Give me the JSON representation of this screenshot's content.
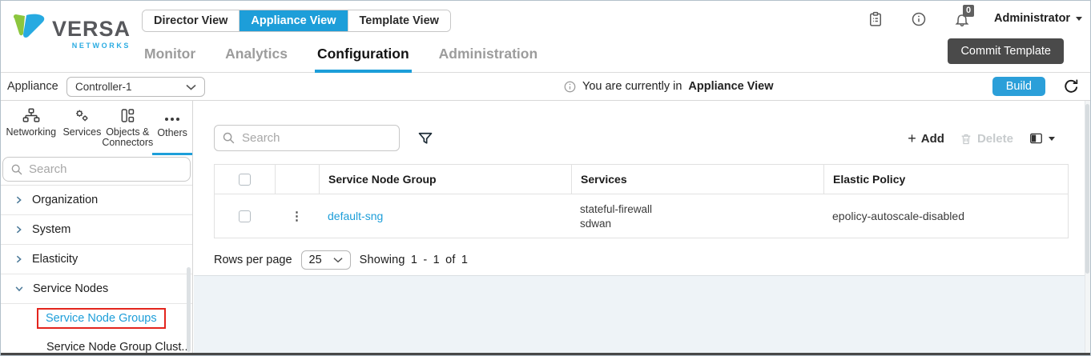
{
  "colors": {
    "accent": "#1d9ed9",
    "highlight_red": "#e3251d",
    "commit_gray": "#4a4a4a"
  },
  "header": {
    "logo": {
      "brand": "VERSA",
      "sub": "NETWORKS"
    },
    "view_tabs": [
      {
        "label": "Director View"
      },
      {
        "label": "Appliance View"
      },
      {
        "label": "Template View"
      }
    ],
    "nav_tabs": [
      {
        "label": "Monitor"
      },
      {
        "label": "Analytics"
      },
      {
        "label": "Configuration"
      },
      {
        "label": "Administration"
      }
    ],
    "notification_count": "0",
    "user_menu_label": "Administrator",
    "commit_button_label": "Commit Template"
  },
  "appliance_bar": {
    "label": "Appliance",
    "selected_appliance": "Controller-1",
    "banner_prefix": "You are currently in",
    "banner_bold": "Appliance View",
    "build_button_label": "Build"
  },
  "sidebar": {
    "tabs": [
      {
        "label": "Networking"
      },
      {
        "label": "Services"
      },
      {
        "label": "Objects & Connectors"
      },
      {
        "label": "Others"
      }
    ],
    "search_placeholder": "Search",
    "tree": [
      {
        "label": "Organization"
      },
      {
        "label": "System"
      },
      {
        "label": "Elasticity"
      },
      {
        "label": "Service Nodes"
      }
    ],
    "service_nodes_children": [
      {
        "label": "Service Node Groups"
      },
      {
        "label": "Service Node Group Clust..."
      }
    ]
  },
  "content": {
    "search_placeholder": "Search",
    "toolbar": {
      "add_label": "Add",
      "delete_label": "Delete"
    },
    "table": {
      "columns": [
        "Service Node Group",
        "Services",
        "Elastic Policy"
      ],
      "rows": [
        {
          "name": "default-sng",
          "services": [
            "stateful-firewall",
            "sdwan"
          ],
          "elastic_policy": "epolicy-autoscale-disabled"
        }
      ]
    },
    "pagination": {
      "rows_per_page_label": "Rows per page",
      "rows_per_page_value": "25",
      "showing_text": "Showing 1 - 1 of 1"
    }
  },
  "icons": {
    "plus": "+",
    "kebab": "⋮"
  }
}
